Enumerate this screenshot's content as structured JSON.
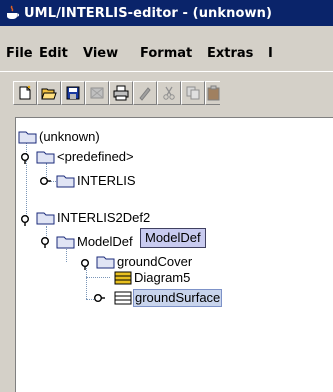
{
  "window": {
    "title": "UML/INTERLIS-editor - (unknown)"
  },
  "menu": [
    "File",
    "Edit",
    "View",
    "Format",
    "Extras",
    "I"
  ],
  "toolbar": [
    "new-icon",
    "open-icon",
    "save-icon",
    "disabled-icon",
    "print-icon",
    "edit-icon",
    "cut-icon",
    "copy-icon",
    "paste-icon"
  ],
  "tree": {
    "root": "(unknown)",
    "predefined": "<predefined>",
    "interlis": "INTERLIS",
    "interlis2def": "INTERLIS2Def2",
    "modeldef": "ModelDef",
    "groundcover": "groundCover",
    "diagram5": "Diagram5",
    "groundsurface": "groundSurface"
  },
  "tooltip": "ModelDef"
}
